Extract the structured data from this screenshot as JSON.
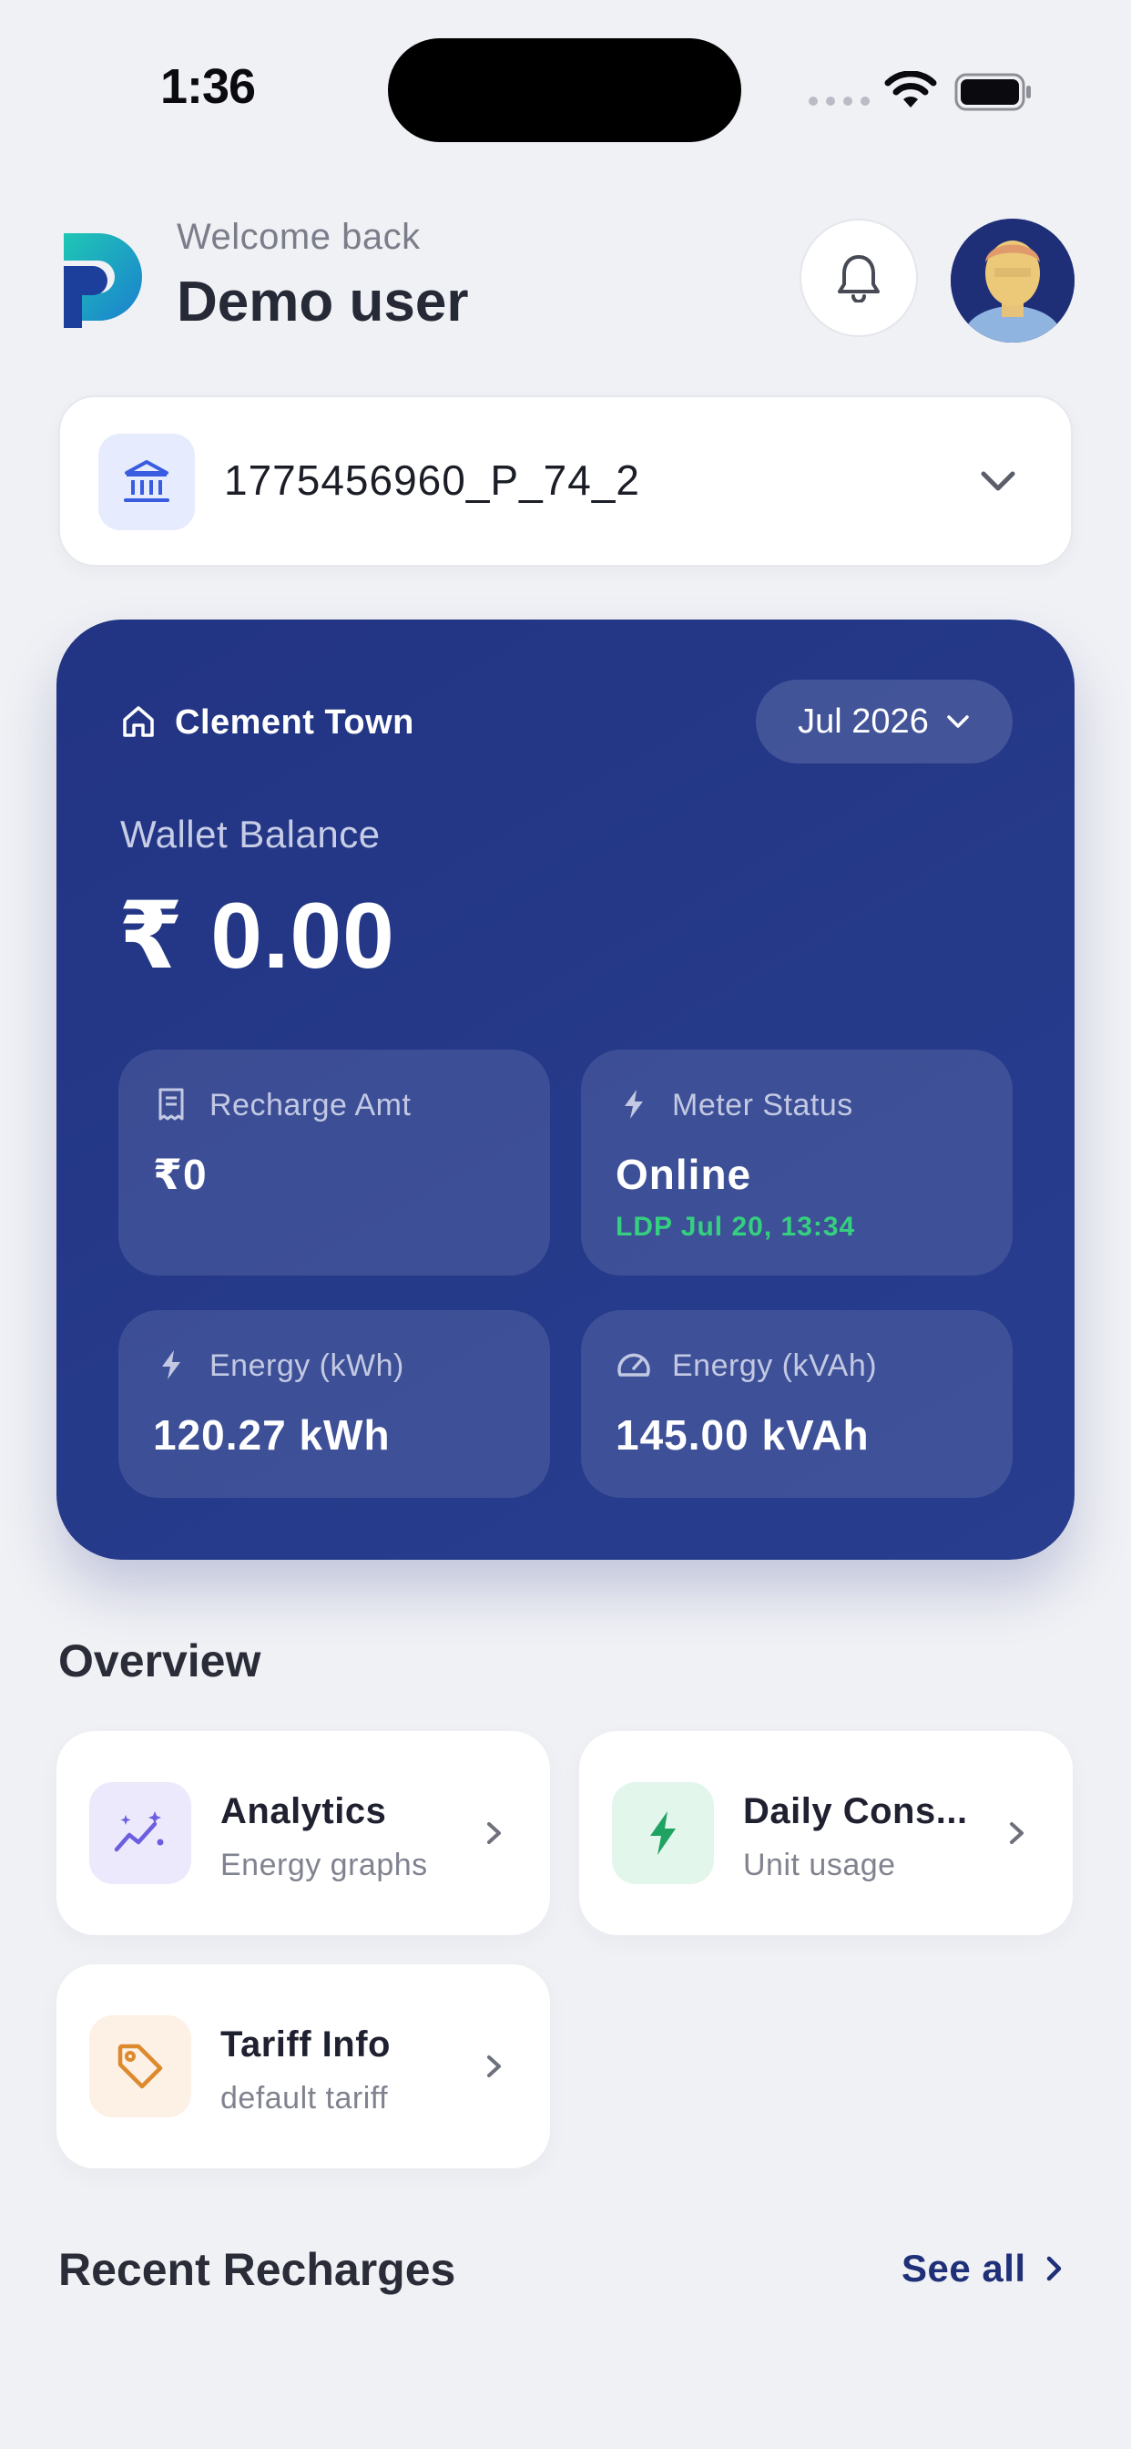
{
  "status_bar": {
    "time": "1:36"
  },
  "header": {
    "welcome": "Welcome back",
    "username": "Demo user"
  },
  "meter_selector": {
    "meter_id": "1775456960_P_74_2"
  },
  "wallet": {
    "location": "Clement Town",
    "month": "Jul 2026",
    "balance_label": "Wallet Balance",
    "balance": "₹ 0.00",
    "stats": {
      "recharge": {
        "label": "Recharge Amt",
        "value": "₹0"
      },
      "meter_status": {
        "label": "Meter Status",
        "value": "Online",
        "sub": "LDP Jul 20, 13:34"
      },
      "energy_kwh": {
        "label": "Energy (kWh)",
        "value": "120.27 kWh"
      },
      "energy_kvah": {
        "label": "Energy (kVAh)",
        "value": "145.00 kVAh"
      }
    }
  },
  "overview": {
    "title": "Overview",
    "cards": [
      {
        "title": "Analytics",
        "subtitle": "Energy graphs",
        "icon": "analytics-icon"
      },
      {
        "title": "Daily Cons...",
        "subtitle": "Unit usage",
        "icon": "bolt-icon"
      },
      {
        "title": "Tariff Info",
        "subtitle": "default tariff",
        "icon": "tag-icon"
      }
    ]
  },
  "recent_recharges": {
    "title": "Recent Recharges",
    "see_all": "See all"
  },
  "colors": {
    "background": "#f0f1f5",
    "wallet_card": "#24378a",
    "status_online": "#35d07f",
    "link": "#1f2f78"
  }
}
